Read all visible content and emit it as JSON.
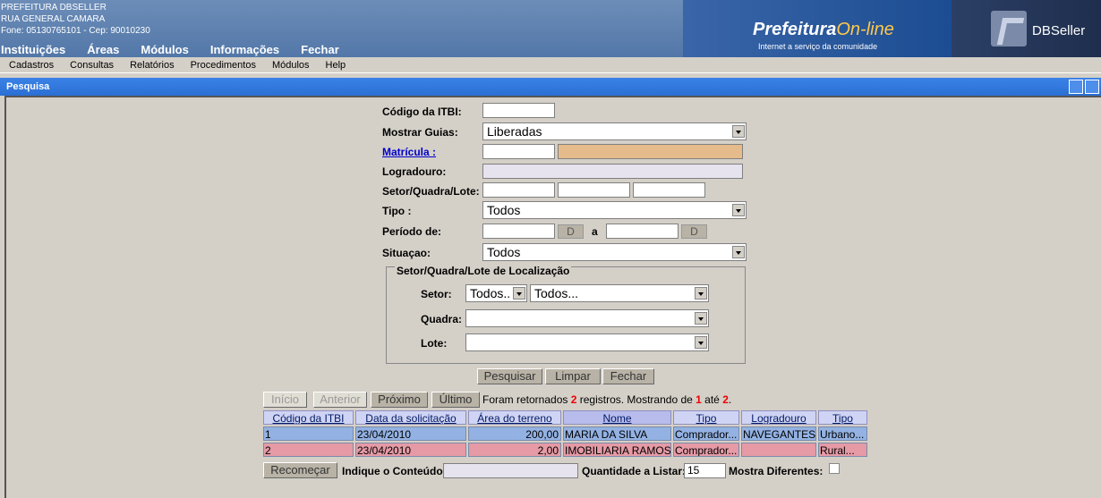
{
  "header": {
    "org": "PREFEITURA DBSELLER",
    "address": "RUA GENERAL CAMARA",
    "phone": "Fone: 05130765101  -  Cep: 90010230",
    "menu": [
      "Instituições",
      "Áreas",
      "Módulos",
      "Informações",
      "Fechar"
    ],
    "brand_title": "Prefeitura",
    "brand_online": "On-line",
    "brand_sub": "Internet a serviço da comunidade",
    "dbseller": "DBSeller"
  },
  "menubar": [
    "Cadastros",
    "Consultas",
    "Relatórios",
    "Procedimentos",
    "Módulos",
    "Help"
  ],
  "window": {
    "title": "Pesquisa"
  },
  "form": {
    "codigo_label": "Código da ITBI:",
    "codigo_value": "",
    "mostrar_label": "Mostrar Guias:",
    "mostrar_value": "Liberadas",
    "matricula_label": "Matrícula :",
    "logradouro_label": "Logradouro:",
    "setor_label": "Setor/Quadra/Lote:",
    "tipo_label": "Tipo :",
    "tipo_value": "Todos",
    "periodo_label": "Período de:",
    "d_btn": "D",
    "a_label": "a",
    "situacao_label": "Situaçao:",
    "situacao_value": "Todos",
    "loc_legend": "Setor/Quadra/Lote de Localização",
    "loc_setor_label": "Setor:",
    "loc_setor_short": "Todos..",
    "loc_setor_long": "Todos...",
    "loc_quadra_label": "Quadra:",
    "loc_lote_label": "Lote:"
  },
  "actions": {
    "pesquisar": "Pesquisar",
    "limpar": "Limpar",
    "fechar": "Fechar"
  },
  "results": {
    "nav": {
      "inicio": "Início",
      "anterior": "Anterior",
      "proximo": "Próximo",
      "ultimo": "Último"
    },
    "status_a": "Foram retornados ",
    "total": "2",
    "status_b": " registros. Mostrando de ",
    "from": "1",
    "status_c": " até ",
    "to": "2",
    "status_d": ".",
    "columns": [
      "Código da ITBI",
      "Data da solicitação",
      "Área do terreno",
      "Nome ",
      "Tipo",
      "Logradouro",
      "Tipo"
    ],
    "rows": [
      [
        "1",
        "23/04/2010",
        "200,00",
        "MARIA DA SILVA",
        "Comprador...",
        "NAVEGANTES",
        "Urbano..."
      ],
      [
        "2",
        "23/04/2010",
        "2,00",
        "IMOBILIARIA RAMOS",
        "Comprador...",
        "",
        "Rural..."
      ]
    ],
    "recomecar": "Recomeçar",
    "indique_label": "Indique o Conteúdo:",
    "quantidade_label": "Quantidade a Listar:",
    "quantidade_value": "15",
    "mostra_label": "Mostra Diferentes:"
  }
}
